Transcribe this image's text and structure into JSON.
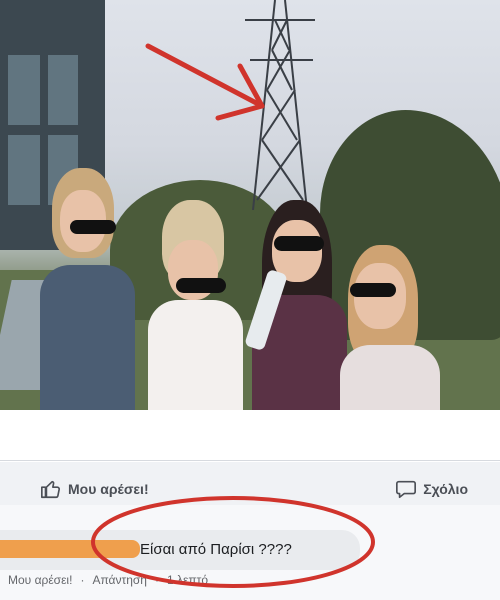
{
  "post": {
    "image_alt": "Group photo of four women with a power line tower in background"
  },
  "actions": {
    "like_label": "Μου αρέσει!",
    "comment_label": "Σχόλιο"
  },
  "comment": {
    "text": "Είσαι από Παρίσι ????",
    "meta_like": "Μου αρέσει!",
    "meta_reply": "Απάντηση",
    "meta_time": "1 λεπτό"
  },
  "colors": {
    "annotation_red": "#d0342c",
    "redaction_orange": "#f0973b",
    "text_gray": "#4b4f56"
  },
  "icons": [
    "thumbs-up-icon",
    "comment-icon",
    "arrow-annotation-icon",
    "circle-annotation-icon"
  ]
}
